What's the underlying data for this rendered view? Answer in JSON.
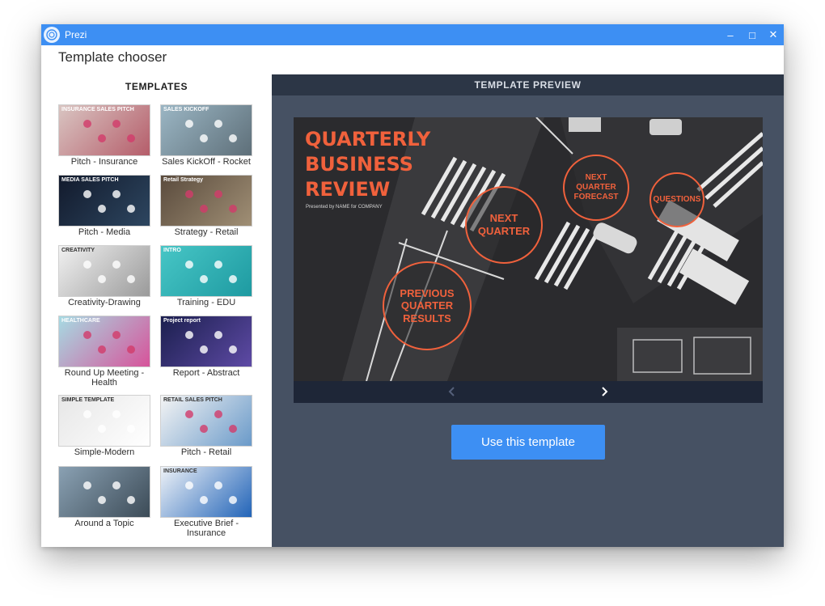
{
  "window": {
    "title": "Prezi",
    "controls": {
      "minimize": "‒",
      "maximize": "□",
      "close": "✕"
    }
  },
  "header": {
    "title": "Template chooser"
  },
  "sidebar": {
    "heading": "TEMPLATES",
    "templates": [
      {
        "label": "Pitch - Insurance",
        "thumb_text": "INSURANCE SALES PITCH",
        "colors": [
          "#d9c5c2",
          "#b55d6a"
        ]
      },
      {
        "label": "Sales KickOff - Rocket",
        "thumb_text": "SALES KICKOFF",
        "colors": [
          "#9bb6c4",
          "#5e6f79"
        ]
      },
      {
        "label": "Pitch - Media",
        "thumb_text": "MEDIA SALES PITCH",
        "colors": [
          "#121a2c",
          "#2d4660"
        ]
      },
      {
        "label": "Strategy - Retail",
        "thumb_text": "Retail Strategy",
        "colors": [
          "#5a4b3d",
          "#a08f75"
        ]
      },
      {
        "label": "Creativity-Drawing",
        "thumb_text": "CREATIVITY",
        "colors": [
          "#f1f1f1",
          "#9a9a9a"
        ]
      },
      {
        "label": "Training - EDU",
        "thumb_text": "INTRO",
        "colors": [
          "#47c6c6",
          "#1e9aa1"
        ]
      },
      {
        "label": "Round Up Meeting - Health",
        "thumb_text": "HEALTHCARE",
        "colors": [
          "#a6dbe3",
          "#d7539a"
        ]
      },
      {
        "label": "Report - Abstract",
        "thumb_text": "Project report",
        "colors": [
          "#1b1f4e",
          "#5e4aa5"
        ]
      },
      {
        "label": "Simple-Modern",
        "thumb_text": "SIMPLE TEMPLATE",
        "colors": [
          "#e7e7e7",
          "#ffffff"
        ]
      },
      {
        "label": "Pitch - Retail",
        "thumb_text": "RETAIL SALES PITCH",
        "colors": [
          "#f4f4f4",
          "#6a9ac9"
        ]
      },
      {
        "label": "Around a Topic",
        "thumb_text": "",
        "colors": [
          "#8aa1b3",
          "#3c4b57"
        ]
      },
      {
        "label": "Executive Brief - Insurance",
        "thumb_text": "INSURANCE",
        "colors": [
          "#eef2f7",
          "#2264b8"
        ]
      }
    ]
  },
  "preview": {
    "heading": "TEMPLATE PREVIEW",
    "slide": {
      "title_lines": [
        "QUARTERLY",
        "BUSINESS",
        "REVIEW"
      ],
      "subtitle": "Presented by NAME for COMPANY",
      "topics": [
        "NEXT QUARTER",
        "NEXT QUARTER FORECAST",
        "QUESTIONS",
        "PREVIOUS QUARTER RESULTS"
      ]
    },
    "nav": {
      "prev_icon": "chevron-left-icon",
      "next_icon": "chevron-right-icon"
    },
    "use_button": "Use this template"
  },
  "colors": {
    "accent": "#3d8ff3",
    "slide_accent": "#f0613c",
    "preview_bg": "#465163",
    "preview_header": "#2c3646"
  }
}
